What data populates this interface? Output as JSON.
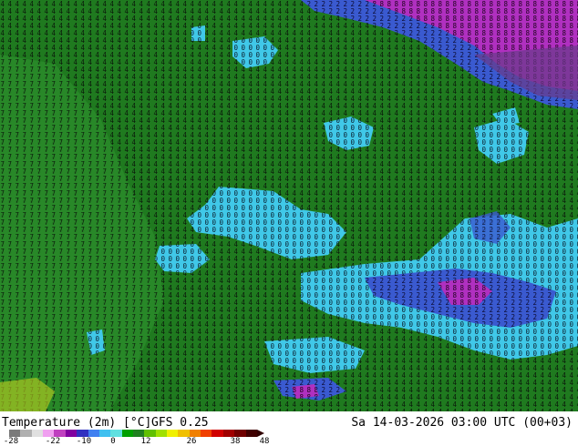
{
  "map": {
    "land_color": "#1f7a1f",
    "grid_number_color": "#000000",
    "water_color": "#1a3a1a"
  },
  "footer": {
    "title": "Temperature (2m) [°C]",
    "model": "GFS 0.25",
    "valid_time": "Sa 14-03-2026 03:00 UTC (00+03)"
  },
  "legend": {
    "ticks": [
      "-28",
      "-22",
      "-10",
      "0",
      "12",
      "26",
      "38",
      "48"
    ],
    "colors": [
      "#7a7a7a",
      "#b0b0b0",
      "#e0e0e0",
      "#f0a0f0",
      "#c040c0",
      "#8000a0",
      "#3030c0",
      "#4080f0",
      "#40c0f0",
      "#60e0e0",
      "#00a000",
      "#208020",
      "#60c000",
      "#a0e000",
      "#f0f000",
      "#f0c000",
      "#f08000",
      "#f04000",
      "#d00000",
      "#a00000",
      "#700000",
      "#400000"
    ]
  }
}
